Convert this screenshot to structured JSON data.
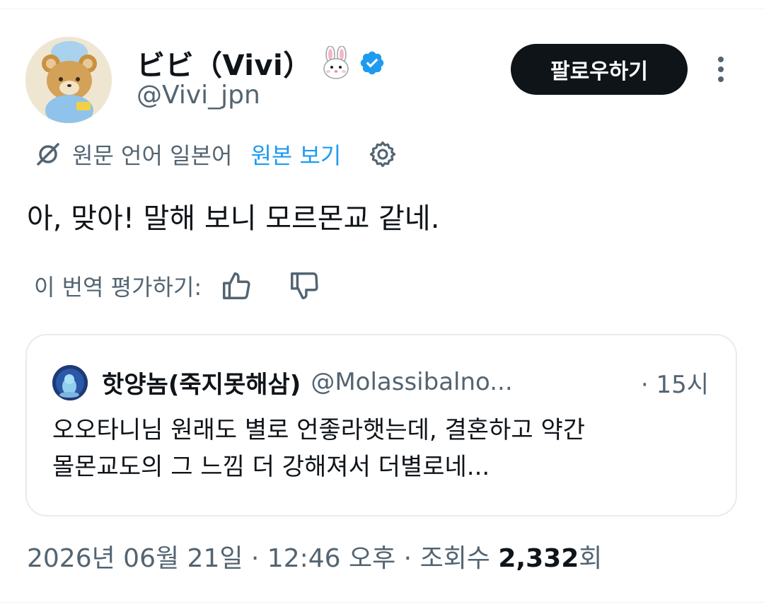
{
  "author": {
    "display_name": "ビビ（Vivi）",
    "emoji_icon": "rabbit-face-icon",
    "verified_icon": "verified-badge-icon",
    "handle": "@Vivi_jpn"
  },
  "follow_label": "팔로우하기",
  "more_icon": "more-vertical-icon",
  "translation": {
    "icon": "translate-icon",
    "source_label": "원문 언어 일본어",
    "view_original_label": "원본 보기",
    "settings_icon": "gear-icon"
  },
  "tweet_text": "아, 맞아! 말해 보니 모르몬교 같네.",
  "rate": {
    "label": "이 번역 평가하기:",
    "up_icon": "thumbs-up-icon",
    "down_icon": "thumbs-down-icon"
  },
  "quote": {
    "name": "핫양놈(죽지못해삼)",
    "handle": "@Molassibalno...",
    "time": "· 15시",
    "text_lines": [
      "오오타니님 원래도 별로 언좋라햇는데, 결혼하고 약간",
      "몰몬교도의 그 느낌 더 강해져서 더별로네..."
    ]
  },
  "meta": {
    "datetime": "2026년 06월 21일 · 12:46 오후 · 조회수 ",
    "views_count": "2,332",
    "views_suffix": "회"
  },
  "colors": {
    "accent": "#1d9bf0",
    "text": "#0f1419",
    "muted": "#536471",
    "border": "#e6ecf0"
  }
}
